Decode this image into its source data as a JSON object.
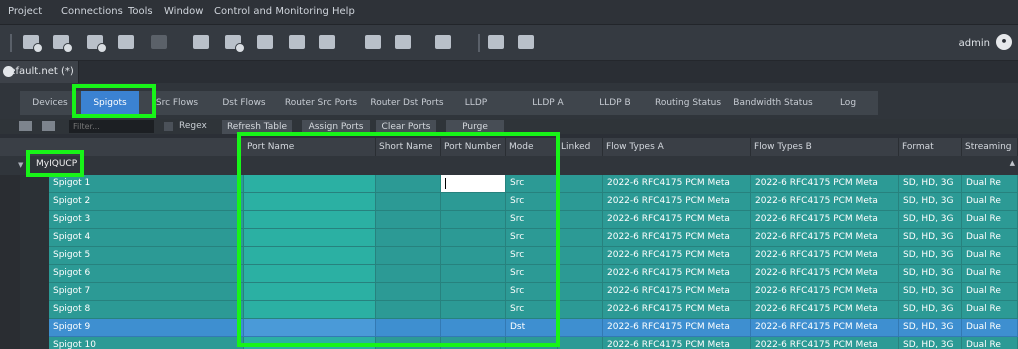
{
  "menu": [
    "Project",
    "Connections",
    "Tools",
    "Window",
    "Control and Monitoring",
    "Help"
  ],
  "toolbar": {
    "user": "admin"
  },
  "document_tab": {
    "label": "default.net (*)"
  },
  "tabs": [
    "Devices",
    "Spigots",
    "Src Flows",
    "Dst Flows",
    "Router Src Ports",
    "Router Dst Ports",
    "LLDP",
    "LLDP A",
    "LLDP B",
    "Routing Status",
    "Bandwidth Status",
    "Log"
  ],
  "active_tab": "Spigots",
  "filter": {
    "placeholder": "Filter...",
    "regex_label": "Regex",
    "buttons": [
      "Refresh Table",
      "Assign Ports",
      "Clear Ports",
      "Purge"
    ]
  },
  "table": {
    "columns": [
      "Port Name",
      "Short Name",
      "Port Number",
      "Mode",
      "Linked",
      "Flow Types A",
      "Flow Types B",
      "Format",
      "Streaming"
    ],
    "group": "MyIQUCP",
    "rows": [
      {
        "name": "Spigot 1",
        "mode": "Src",
        "flow_a": "2022-6  RFC4175  PCM  Meta",
        "flow_b": "2022-6  RFC4175  PCM  Meta",
        "format": "SD, HD, 3G",
        "streaming": "Dual Re"
      },
      {
        "name": "Spigot 2",
        "mode": "Src",
        "flow_a": "2022-6  RFC4175  PCM  Meta",
        "flow_b": "2022-6  RFC4175  PCM  Meta",
        "format": "SD, HD, 3G",
        "streaming": "Dual Re"
      },
      {
        "name": "Spigot 3",
        "mode": "Src",
        "flow_a": "2022-6  RFC4175  PCM  Meta",
        "flow_b": "2022-6  RFC4175  PCM  Meta",
        "format": "SD, HD, 3G",
        "streaming": "Dual Re"
      },
      {
        "name": "Spigot 4",
        "mode": "Src",
        "flow_a": "2022-6  RFC4175  PCM  Meta",
        "flow_b": "2022-6  RFC4175  PCM  Meta",
        "format": "SD, HD, 3G",
        "streaming": "Dual Re"
      },
      {
        "name": "Spigot 5",
        "mode": "Src",
        "flow_a": "2022-6  RFC4175  PCM  Meta",
        "flow_b": "2022-6  RFC4175  PCM  Meta",
        "format": "SD, HD, 3G",
        "streaming": "Dual Re"
      },
      {
        "name": "Spigot 6",
        "mode": "Src",
        "flow_a": "2022-6  RFC4175  PCM  Meta",
        "flow_b": "2022-6  RFC4175  PCM  Meta",
        "format": "SD, HD, 3G",
        "streaming": "Dual Re"
      },
      {
        "name": "Spigot 7",
        "mode": "Src",
        "flow_a": "2022-6  RFC4175  PCM  Meta",
        "flow_b": "2022-6  RFC4175  PCM  Meta",
        "format": "SD, HD, 3G",
        "streaming": "Dual Re"
      },
      {
        "name": "Spigot 8",
        "mode": "Src",
        "flow_a": "2022-6  RFC4175  PCM  Meta",
        "flow_b": "2022-6  RFC4175  PCM  Meta",
        "format": "SD, HD, 3G",
        "streaming": "Dual Re"
      },
      {
        "name": "Spigot 9",
        "mode": "Dst",
        "flow_a": "2022-6  RFC4175  PCM  Meta",
        "flow_b": "2022-6  RFC4175  PCM  Meta",
        "format": "SD, HD, 3G",
        "streaming": "Dual Re"
      },
      {
        "name": "Spigot 10",
        "mode": "",
        "flow_a": "2022-6  RFC4175  PCM  Meta",
        "flow_b": "2022-6  RFC4175  PCM  Meta",
        "format": "SD, HD, 3G",
        "streaming": "Dual Re"
      }
    ]
  },
  "colors": {
    "row": "#2c9a95",
    "selected_row": "#3e8fd0",
    "active_tab": "#3b82d2",
    "highlight": "#18f418"
  }
}
